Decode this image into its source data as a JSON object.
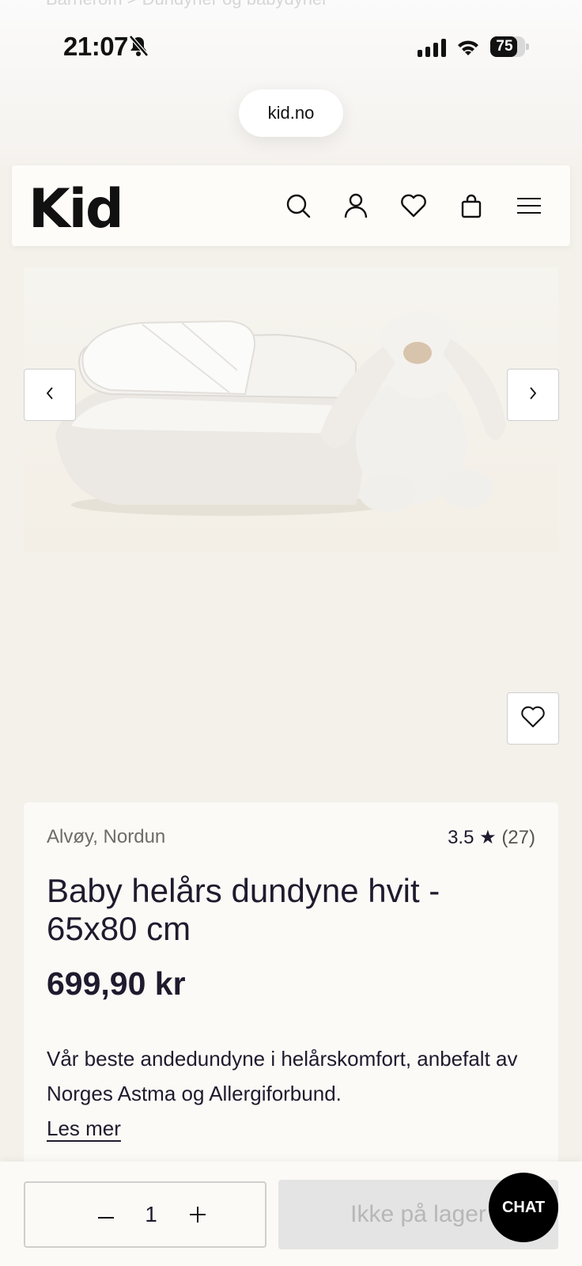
{
  "breadcrumb": "Barnerom  >  Dundyner og babydyner",
  "status": {
    "time": "21:07",
    "battery": "75"
  },
  "browser": {
    "url": "kid.no"
  },
  "header": {
    "logo": "Kid",
    "icons": [
      "search-icon",
      "user-icon",
      "heart-icon",
      "bag-icon",
      "menu-icon"
    ]
  },
  "product": {
    "brand": "Alvøy, Nordun",
    "rating": "3.5",
    "review_count": "(27)",
    "title": "Baby helårs dundyne hvit - 65x80 cm",
    "price": "699,90 kr",
    "description": "Vår beste andedundyne i helårskomfort, anbefalt av Norges Astma og Allergiforbund.",
    "read_more": "Les mer"
  },
  "purchase": {
    "quantity": "1",
    "stock_label": "Ikke på lager"
  },
  "chat_label": "CHAT",
  "colors": {
    "background": "#f4f1eb",
    "text": "#1f1b2e",
    "chat": "#000000"
  }
}
